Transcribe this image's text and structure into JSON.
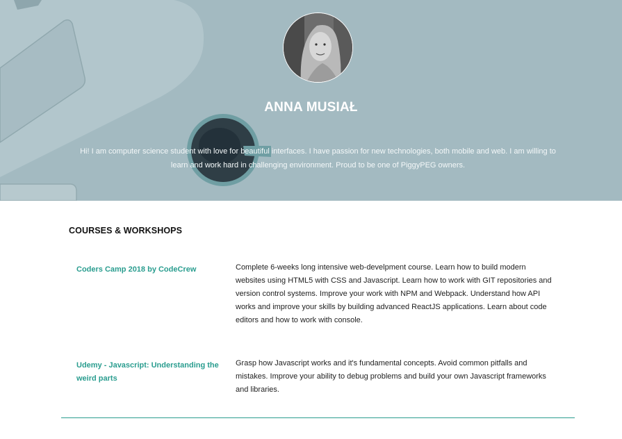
{
  "profile": {
    "name": "ANNA MUSIAŁ",
    "bio": "Hi! I am computer science student with love for beautiful interfaces. I have passion for new technologies, both mobile and web. I am willing to learn and work hard in challenging environment. Proud to be one of PiggyPEG owners."
  },
  "courses": {
    "title": "COURSES & WORKSHOPS",
    "items": [
      {
        "name": "Coders Camp 2018 by CodeCrew",
        "description": "Complete 6-weeks long intensive web-develpment course. Learn how to build modern websites using HTML5 with CSS and Javascript. Learn how to work with GIT repositories and version control systems. Improve your work with NPM and Webpack. Understand how API works and improve your skills by building advanced ReactJS applications. Learn about code editors and how to work with console."
      },
      {
        "name": "Udemy - Javascript: Understanding the weird parts",
        "description": "Grasp how Javascript works and it's fundamental concepts. Avoid common pitfalls and mistakes. Improve your ability to debug problems and build your own Javascript frameworks and libraries."
      }
    ]
  },
  "colors": {
    "accent": "#2a9d8f",
    "hero_overlay": "#a2b9c0"
  }
}
